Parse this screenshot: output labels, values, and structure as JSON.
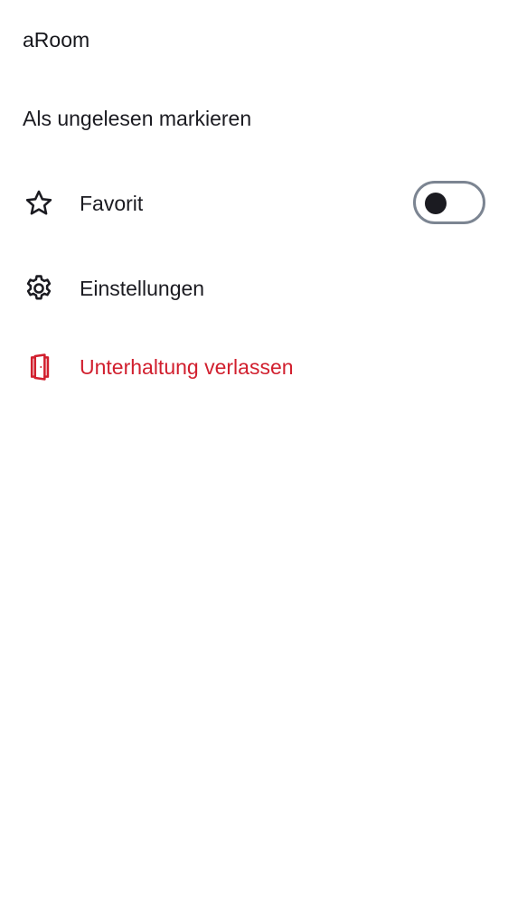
{
  "header": {
    "room_name": "aRoom"
  },
  "menu": {
    "mark_unread": {
      "label": "Als ungelesen markieren"
    },
    "favorite": {
      "label": "Favorit",
      "icon": "star-icon",
      "toggle_on": false
    },
    "settings": {
      "label": "Einstellungen",
      "icon": "gear-icon"
    },
    "leave": {
      "label": "Unterhaltung verlassen",
      "icon": "door-exit-icon",
      "color": "#d11f2e"
    }
  }
}
